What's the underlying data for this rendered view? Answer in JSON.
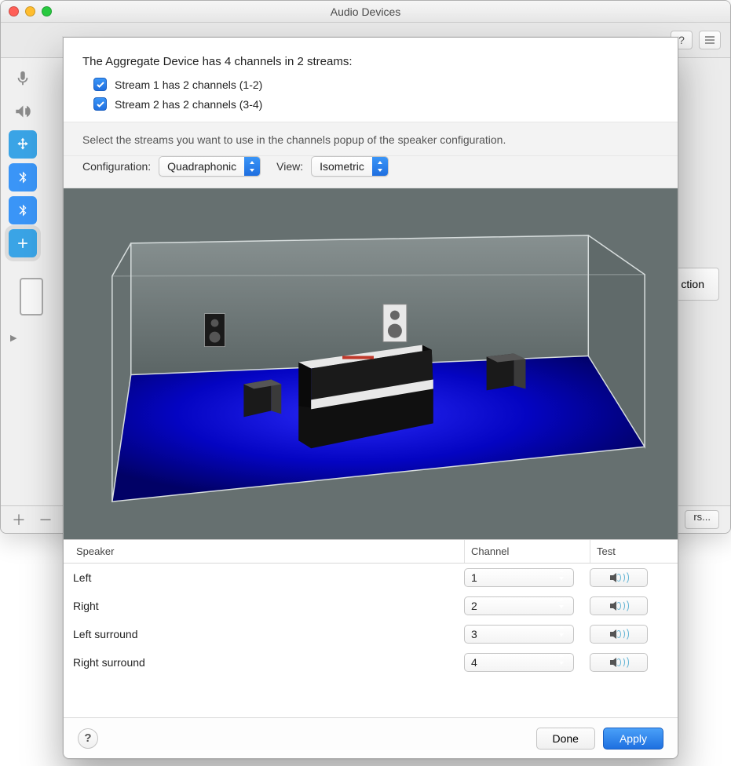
{
  "window": {
    "title": "Audio Devices",
    "right_button_peek": "ction",
    "bottom_right_button_peek": "rs...",
    "sidebar_icons": [
      "microphone-icon",
      "speaker-icon",
      "usb-icon",
      "bluetooth-icon",
      "bluetooth-icon",
      "aggregate-icon",
      "iphone-icon"
    ]
  },
  "sheet": {
    "heading": "The Aggregate Device has 4 channels in 2 streams:",
    "streams": [
      {
        "checked": true,
        "label": "Stream 1 has 2 channels (1-2)"
      },
      {
        "checked": true,
        "label": "Stream 2 has 2 channels (3-4)"
      }
    ],
    "hint": "Select the streams you want to use in the channels popup of the speaker configuration.",
    "configuration_label": "Configuration:",
    "configuration_value": "Quadraphonic",
    "view_label": "View:",
    "view_value": "Isometric",
    "columns": {
      "speaker": "Speaker",
      "channel": "Channel",
      "test": "Test"
    },
    "speakers": [
      {
        "name": "Left",
        "channel": "1"
      },
      {
        "name": "Right",
        "channel": "2"
      },
      {
        "name": "Left surround",
        "channel": "3"
      },
      {
        "name": "Right surround",
        "channel": "4"
      }
    ],
    "buttons": {
      "done": "Done",
      "apply": "Apply"
    }
  }
}
